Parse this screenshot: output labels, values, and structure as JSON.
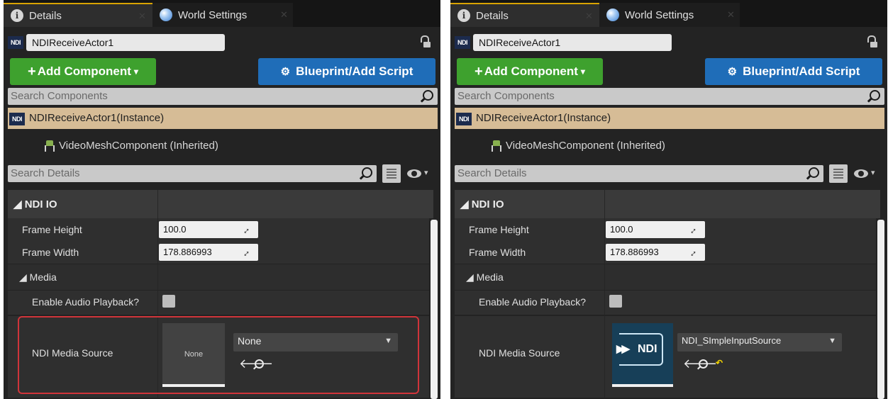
{
  "panels": [
    {
      "tabs": {
        "details": "Details",
        "world_settings": "World Settings"
      },
      "actor_name": "NDIReceiveActor1",
      "add_component_label": "Add Component",
      "blueprint_label": "Blueprint/Add Script",
      "search_components_placeholder": "Search Components",
      "instance_label": "NDIReceiveActor1(Instance)",
      "inherited_label": "VideoMeshComponent (Inherited)",
      "search_details_placeholder": "Search Details",
      "category_ndi_io": "NDI IO",
      "frame_height_label": "Frame Height",
      "frame_height_value": "100.0",
      "frame_width_label": "Frame Width",
      "frame_width_value": "178.886993",
      "category_media": "Media",
      "enable_audio_label": "Enable Audio Playback?",
      "enable_audio_checked": false,
      "ndi_media_source_label": "NDI Media Source",
      "ndi_media_source_value": "None",
      "thumbnail_text": "None",
      "highlighted": true
    },
    {
      "tabs": {
        "details": "Details",
        "world_settings": "World Settings"
      },
      "actor_name": "NDIReceiveActor1",
      "add_component_label": "Add Component",
      "blueprint_label": "Blueprint/Add Script",
      "search_components_placeholder": "Search Components",
      "instance_label": "NDIReceiveActor1(Instance)",
      "inherited_label": "VideoMeshComponent (Inherited)",
      "search_details_placeholder": "Search Details",
      "category_ndi_io": "NDI IO",
      "frame_height_label": "Frame Height",
      "frame_height_value": "100.0",
      "frame_width_label": "Frame Width",
      "frame_width_value": "178.886993",
      "category_media": "Media",
      "enable_audio_label": "Enable Audio Playback?",
      "enable_audio_checked": false,
      "ndi_media_source_label": "NDI Media Source",
      "ndi_media_source_value": "NDI_SImpleInputSource",
      "thumbnail_text": "NDI",
      "highlighted": false
    }
  ],
  "icons": {
    "info": "info-icon",
    "globe": "globe-icon",
    "lock": "lock-icon",
    "search": "search-icon",
    "mesh": "mesh-component-icon",
    "list_view": "list-view-icon",
    "eye": "eye-icon",
    "use_selected": "arrow-left-icon",
    "reset": "reset-to-default-icon"
  },
  "colors": {
    "add_component": "#3ea12e",
    "blueprint": "#1f6db8",
    "instance_row": "#d6bc96",
    "highlight": "#d0343a",
    "tab_accent": "#d9a400"
  }
}
